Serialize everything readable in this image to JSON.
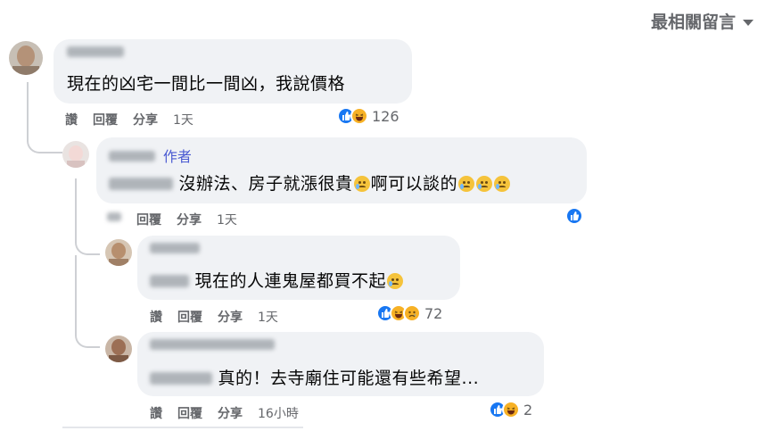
{
  "sort": {
    "label": "最相關留言"
  },
  "comments": [
    {
      "name": "程海東",
      "text": "現在的凶宅一間比一間凶，我說價格",
      "actions": [
        "讚",
        "回覆",
        "分享"
      ],
      "time": "1天",
      "reactions": {
        "icons": [
          "like-icon",
          "haha-icon"
        ],
        "count": "126"
      }
    },
    {
      "author_badge": "作者",
      "text": "沒辦法、房子就漲很貴",
      "text2": "啊可以談的",
      "actions": [
        "讚",
        "回覆",
        "分享"
      ],
      "time": "1天",
      "reactions": {
        "icons": [
          "like-icon"
        ],
        "count": ""
      }
    },
    {
      "text": "現在的人連鬼屋都買不起",
      "actions": [
        "讚",
        "回覆",
        "分享"
      ],
      "time": "1天",
      "reactions": {
        "icons": [
          "like-icon",
          "haha-icon",
          "sad-icon"
        ],
        "count": "72"
      }
    },
    {
      "text": "真的！去寺廟住可能還有些希望...",
      "actions": [
        "讚",
        "回覆",
        "分享"
      ],
      "time": "16小時",
      "reactions": {
        "icons": [
          "like-icon",
          "haha-icon"
        ],
        "count": "2"
      }
    }
  ],
  "colors": {
    "bubble": "#f0f2f5",
    "meta": "#65676b",
    "like": "#1877f2",
    "author": "#4b5bd2"
  }
}
